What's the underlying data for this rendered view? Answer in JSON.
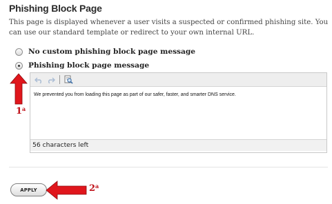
{
  "section": {
    "title": "Phishing Block Page",
    "description": "This page is displayed whenever a user visits a suspected or confirmed phishing site. You can use our standard template or redirect to your own internal URL."
  },
  "options": [
    {
      "label": "No custom phishing block page message",
      "selected": false
    },
    {
      "label": "Phishing block page message",
      "selected": true
    }
  ],
  "editor": {
    "toolbar": [
      "undo-icon",
      "redo-icon",
      "find-replace-icon"
    ],
    "content": "We prevented you from loading this page as part of our safer, faster, and smarter DNS service.",
    "status": "56 characters left"
  },
  "actions": {
    "apply_label": "APPLY"
  },
  "annotations": [
    {
      "number": "1",
      "suffix": "a"
    },
    {
      "number": "2",
      "suffix": "a"
    }
  ],
  "colors": {
    "annotation": "#c0141c",
    "arrow": "#e0161c"
  }
}
